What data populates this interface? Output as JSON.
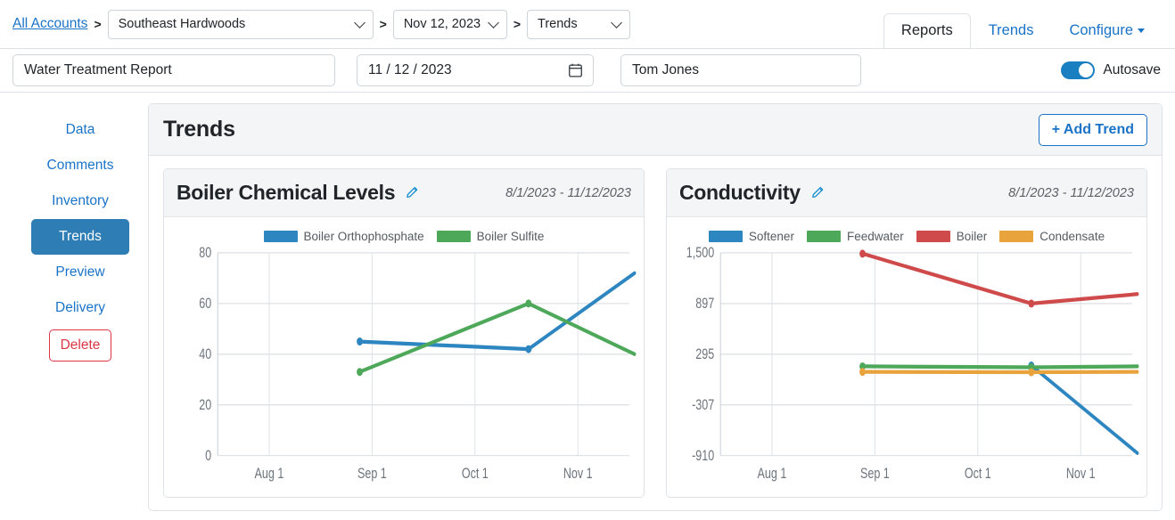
{
  "breadcrumb": {
    "root_label": "All Accounts",
    "sep": ">",
    "account": "Southeast Hardwoods",
    "date": "Nov 12, 2023",
    "section": "Trends"
  },
  "nav_tabs": [
    {
      "label": "Reports",
      "active": true,
      "caret": false
    },
    {
      "label": "Trends",
      "active": false,
      "caret": false
    },
    {
      "label": "Configure",
      "active": false,
      "caret": true
    }
  ],
  "meta": {
    "report_title": "Water Treatment Report",
    "report_title_placeholder": "Report Title",
    "report_date": "11 / 12 / 2023",
    "user": "Tom Jones",
    "autosave_label": "Autosave",
    "autosave_on": true
  },
  "sidebar": {
    "items": [
      {
        "label": "Data",
        "active": false,
        "danger": false
      },
      {
        "label": "Comments",
        "active": false,
        "danger": false
      },
      {
        "label": "Inventory",
        "active": false,
        "danger": false
      },
      {
        "label": "Trends",
        "active": true,
        "danger": false
      },
      {
        "label": "Preview",
        "active": false,
        "danger": false
      },
      {
        "label": "Delivery",
        "active": false,
        "danger": false
      },
      {
        "label": "Delete",
        "active": false,
        "danger": true
      }
    ]
  },
  "panel": {
    "title": "Trends",
    "add_button_label": "+ Add Trend"
  },
  "colors": {
    "blue": "#2e86c1",
    "green": "#54a css",
    "series_blue": "#2e86c1",
    "series_green": "#4da85a",
    "series_red": "#cf4b4b",
    "series_orange": "#e8a33d",
    "accent_link": "#1a73c7",
    "danger": "#dc3545",
    "sidebar_active_bg": "#2e7db5"
  },
  "chart_data": [
    {
      "type": "line",
      "title": "Boiler Chemical Levels",
      "date_range": "8/1/2023 - 11/12/2023",
      "xlabel": "",
      "ylabel": "",
      "grid": true,
      "legend_position": "top",
      "x_ticks": [
        "Aug 1",
        "Sep 1",
        "Oct 1",
        "Nov 1"
      ],
      "y_ticks": [
        0,
        20,
        40,
        60,
        80
      ],
      "ylim": [
        0,
        80
      ],
      "series": [
        {
          "name": "Boiler Orthophosphate",
          "color": "#2e86c1",
          "x": [
            1.38,
            3.02,
            4.05
          ],
          "values": [
            45,
            42,
            72
          ]
        },
        {
          "name": "Boiler Sulfite",
          "color": "#4da85a",
          "x": [
            1.38,
            3.02,
            4.05
          ],
          "values": [
            33,
            60,
            40
          ]
        }
      ]
    },
    {
      "type": "line",
      "title": "Conductivity",
      "date_range": "8/1/2023 - 11/12/2023",
      "xlabel": "",
      "ylabel": "",
      "grid": true,
      "legend_position": "top",
      "x_ticks": [
        "Aug 1",
        "Sep 1",
        "Oct 1",
        "Nov 1"
      ],
      "y_ticks": [
        1500,
        897,
        295,
        -307,
        -910
      ],
      "y_tick_labels": [
        "1,500",
        "897",
        "295",
        "-307",
        "-910"
      ],
      "ylim": [
        -910,
        1500
      ],
      "series": [
        {
          "name": "Softener",
          "color": "#2e86c1",
          "x": [
            3.02,
            4.05
          ],
          "values": [
            160,
            -880
          ]
        },
        {
          "name": "Feedwater",
          "color": "#4da85a",
          "x": [
            1.38,
            3.02,
            4.05
          ],
          "values": [
            150,
            140,
            150
          ]
        },
        {
          "name": "Boiler",
          "color": "#cf4b4b",
          "x": [
            1.38,
            3.02,
            4.05
          ],
          "values": [
            1490,
            897,
            1010
          ]
        },
        {
          "name": "Condensate",
          "color": "#e8a33d",
          "x": [
            1.38,
            3.02,
            4.05
          ],
          "values": [
            85,
            80,
            85
          ]
        }
      ]
    }
  ]
}
